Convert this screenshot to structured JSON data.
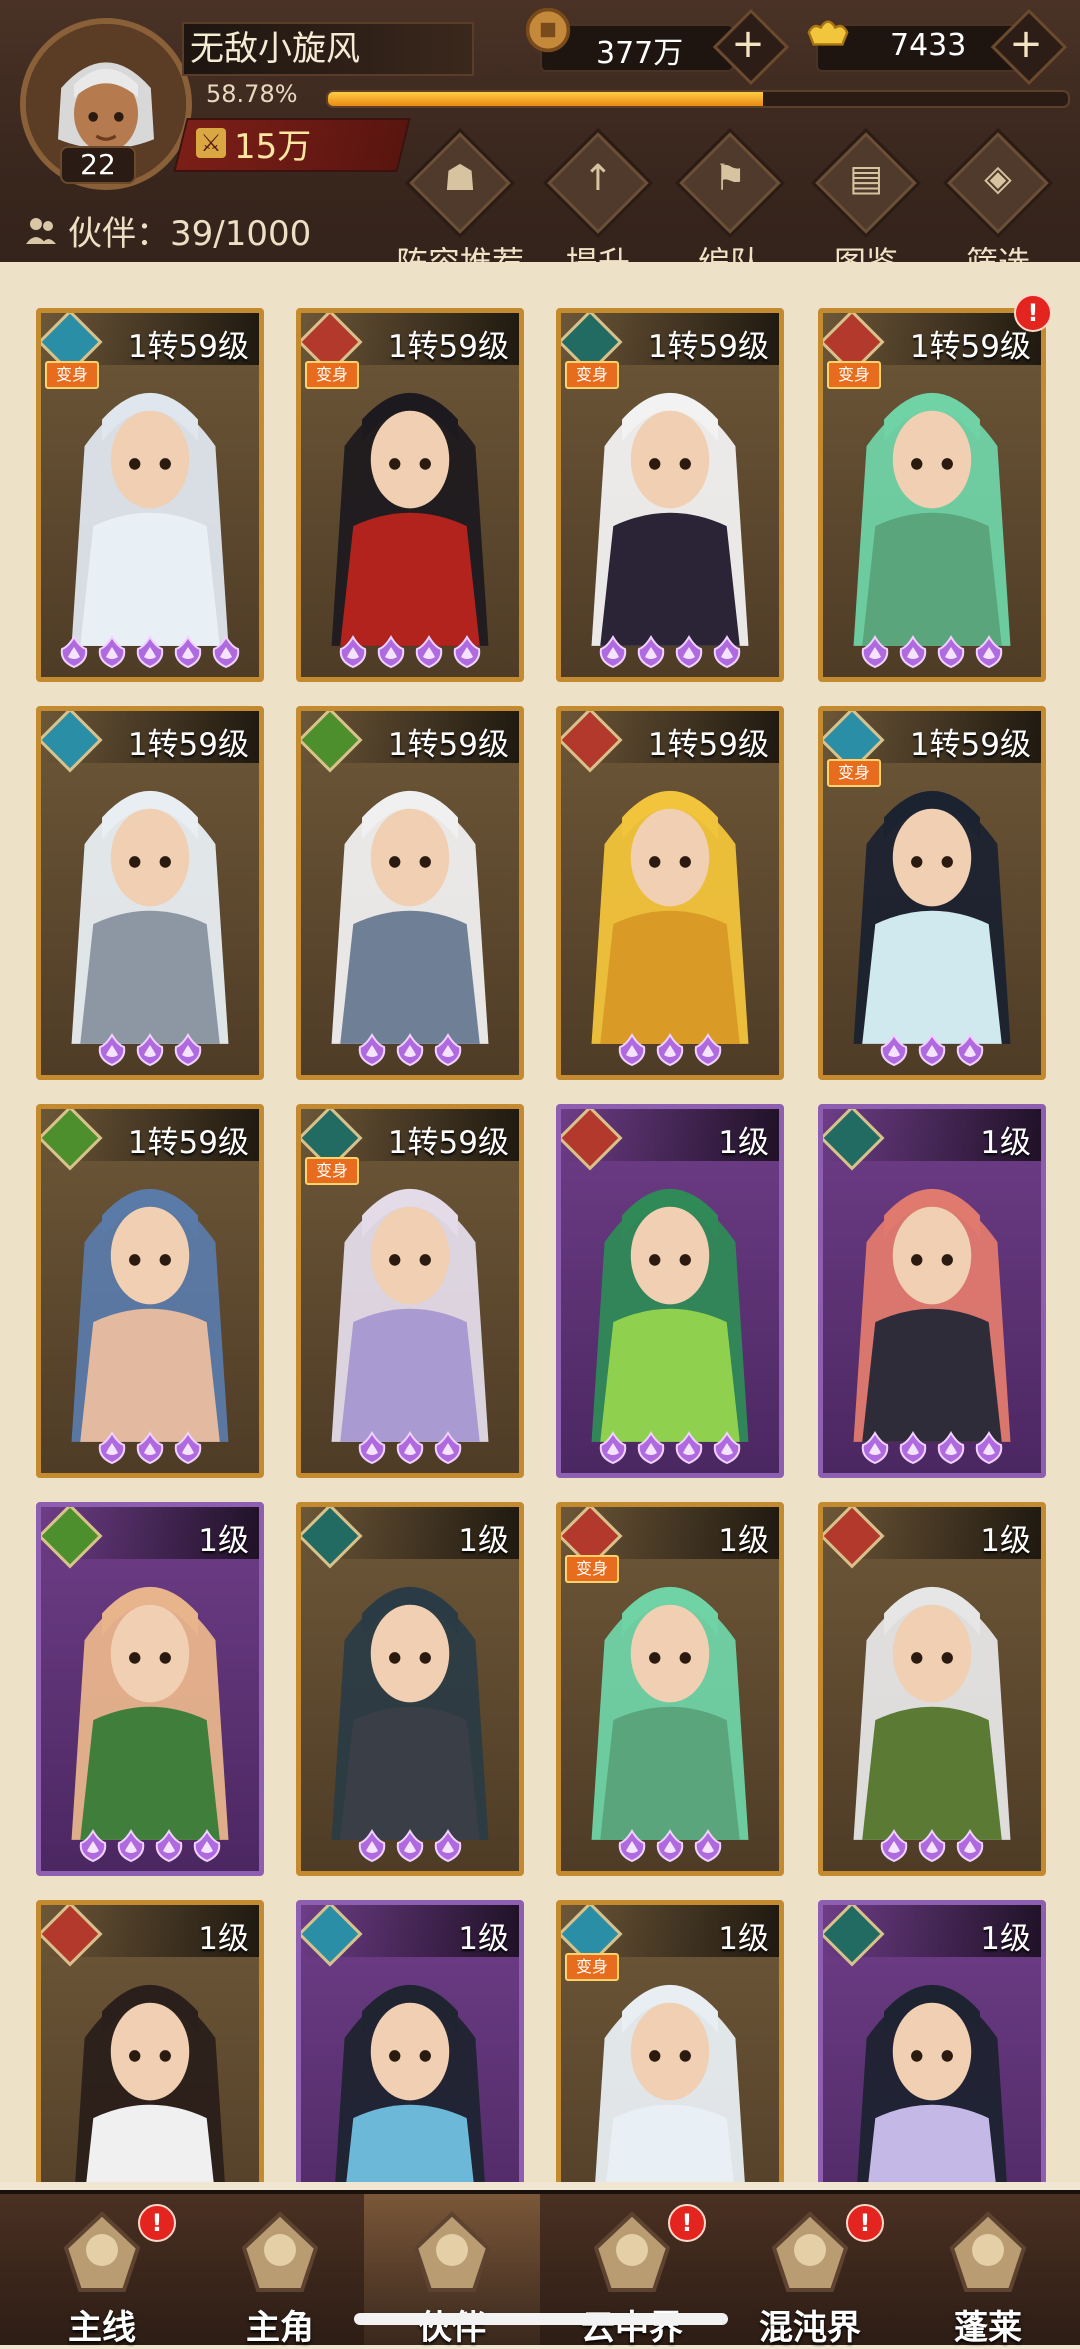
{
  "player": {
    "name": "无敌小旋风",
    "level": "22",
    "exp_text": "58.78%",
    "exp_fraction": 0.5878,
    "power": "15万"
  },
  "resources": {
    "coins": "377万",
    "gold": "7433"
  },
  "partners": {
    "label": "伙伴：39/1000"
  },
  "menu": [
    {
      "label": "阵容推荐",
      "icon": "recommend-icon"
    },
    {
      "label": "提升",
      "icon": "upgrade-icon"
    },
    {
      "label": "编队",
      "icon": "formation-icon"
    },
    {
      "label": "图鉴",
      "icon": "codex-icon"
    },
    {
      "label": "筛选",
      "icon": "filter-icon"
    }
  ],
  "cards": [
    {
      "level": "1转59级",
      "element": "water",
      "transform": "变身",
      "stars": 5,
      "frame": "gold",
      "hair": "#dfe6ee",
      "cloth": "#e9f0f5",
      "alert": false
    },
    {
      "level": "1转59级",
      "element": "fire",
      "transform": "变身",
      "stars": 4,
      "frame": "gold",
      "hair": "#1d1a1f",
      "cloth": "#b3231d",
      "alert": false
    },
    {
      "level": "1转59级",
      "element": "dark",
      "transform": "变身",
      "stars": 4,
      "frame": "gold",
      "hair": "#f2f2f2",
      "cloth": "#2a2436",
      "alert": false
    },
    {
      "level": "1转59级",
      "element": "fire",
      "transform": "变身",
      "stars": 4,
      "frame": "gold",
      "hair": "#6fd3a6",
      "cloth": "#5aa57b",
      "alert": true
    },
    {
      "level": "1转59级",
      "element": "water",
      "transform": "",
      "stars": 3,
      "frame": "gold",
      "hair": "#e8eef2",
      "cloth": "#8d97a3",
      "alert": false
    },
    {
      "level": "1转59级",
      "element": "wind",
      "transform": "",
      "stars": 3,
      "frame": "gold",
      "hair": "#f0f0f0",
      "cloth": "#6f7f95",
      "alert": false
    },
    {
      "level": "1转59级",
      "element": "fire",
      "transform": "",
      "stars": 3,
      "frame": "gold",
      "hair": "#f2c43b",
      "cloth": "#d99a26",
      "alert": false
    },
    {
      "level": "1转59级",
      "element": "water",
      "transform": "变身",
      "stars": 3,
      "frame": "gold",
      "hair": "#1b2230",
      "cloth": "#cfe9ee",
      "alert": false
    },
    {
      "level": "1转59级",
      "element": "wind",
      "transform": "",
      "stars": 3,
      "frame": "gold",
      "hair": "#5a7aa8",
      "cloth": "#e3b9a0",
      "alert": false
    },
    {
      "level": "1转59级",
      "element": "dark",
      "transform": "变身",
      "stars": 3,
      "frame": "gold",
      "hair": "#e3dbe8",
      "cloth": "#a99bd1",
      "alert": false
    },
    {
      "level": "1级",
      "element": "fire",
      "transform": "",
      "stars": 4,
      "frame": "purple",
      "hair": "#2f8a57",
      "cloth": "#8fd14f",
      "alert": false
    },
    {
      "level": "1级",
      "element": "dark",
      "transform": "",
      "stars": 4,
      "frame": "purple",
      "hair": "#e07a6e",
      "cloth": "#2f2c3a",
      "alert": false
    },
    {
      "level": "1级",
      "element": "wind",
      "transform": "",
      "stars": 4,
      "frame": "purple",
      "hair": "#e8b48c",
      "cloth": "#3f7f3b",
      "alert": false
    },
    {
      "level": "1级",
      "element": "dark",
      "transform": "",
      "stars": 3,
      "frame": "gold",
      "hair": "#2b3b45",
      "cloth": "#3a3f47",
      "alert": false
    },
    {
      "level": "1级",
      "element": "fire",
      "transform": "变身",
      "stars": 3,
      "frame": "gold",
      "hair": "#6fd3a6",
      "cloth": "#5aa57b",
      "alert": false
    },
    {
      "level": "1级",
      "element": "fire",
      "transform": "",
      "stars": 3,
      "frame": "gold",
      "hair": "#e6e6e6",
      "cloth": "#5b7a34",
      "alert": false
    },
    {
      "level": "1级",
      "element": "fire",
      "transform": "",
      "stars": 0,
      "frame": "gold",
      "hair": "#2a1f1a",
      "cloth": "#f0f0f0",
      "alert": false
    },
    {
      "level": "1级",
      "element": "water",
      "transform": "",
      "stars": 0,
      "frame": "purple",
      "hair": "#1f2430",
      "cloth": "#6bb8d9",
      "alert": false
    },
    {
      "level": "1级",
      "element": "water",
      "transform": "变身",
      "stars": 0,
      "frame": "gold",
      "hair": "#e8eef2",
      "cloth": "#e9f0f5",
      "alert": false
    },
    {
      "level": "1级",
      "element": "dark",
      "transform": "",
      "stars": 0,
      "frame": "purple",
      "hair": "#1d2330",
      "cloth": "#c4b9e6",
      "alert": false
    }
  ],
  "nav": [
    {
      "label": "主线",
      "icon": "crossed-swords-icon",
      "active": false,
      "alert": true
    },
    {
      "label": "主角",
      "icon": "hero-icon",
      "active": false,
      "alert": false
    },
    {
      "label": "伙伴",
      "icon": "partner-icon",
      "active": true,
      "alert": false
    },
    {
      "label": "云中界",
      "icon": "pagoda-icon",
      "active": false,
      "alert": true
    },
    {
      "label": "混沌界",
      "icon": "chaos-icon",
      "active": false,
      "alert": true
    },
    {
      "label": "蓬莱",
      "icon": "penglai-icon",
      "active": false,
      "alert": false
    }
  ],
  "colors": {
    "accent": "#e88b12",
    "gold_frame": "#c48a30",
    "purple_frame": "#8e5fb0",
    "alert": "#e3241f"
  }
}
